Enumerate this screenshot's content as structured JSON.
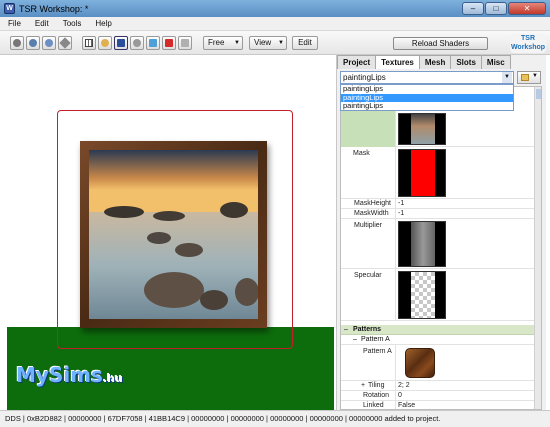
{
  "window": {
    "title": "TSR Workshop: *",
    "minimize": "–",
    "maximize": "□",
    "close": "✕",
    "app_icon": "W"
  },
  "menu": [
    "File",
    "Edit",
    "Tools",
    "Help"
  ],
  "toolbar": {
    "view_mode_dropdown": "Free",
    "view_dropdown": "View",
    "edit_button": "Edit",
    "reload_button": "Reload Shaders",
    "logo_text": "TSR Workshop"
  },
  "viewport": {
    "watermark": "MySims",
    "watermark_suffix": ".hu"
  },
  "panel": {
    "tabs": [
      "Project",
      "Textures",
      "Mesh",
      "Slots",
      "Misc"
    ],
    "active_tab": "Textures",
    "combo": {
      "selected": "paintingLips",
      "options": [
        "paintingLips",
        "paintingLips",
        "paintingLips"
      ],
      "highlighted_index": 1
    },
    "props": [
      {
        "name": "Mask",
        "kind": "texture"
      },
      {
        "name": "MaskHeight",
        "value": "-1"
      },
      {
        "name": "MaskWidth",
        "value": "-1"
      },
      {
        "name": "Multiplier",
        "kind": "texture"
      },
      {
        "name": "Specular",
        "kind": "texture"
      }
    ],
    "patterns": {
      "section_label": "Patterns",
      "section_toggle": "–",
      "sub_label": "Pattern A",
      "sub_toggle": "–",
      "item_label": "Pattern A",
      "tiling_toggle": "+",
      "tiling_label": "Tiling",
      "tiling_value": "2; 2",
      "rotation_label": "Rotation",
      "rotation_value": "0",
      "linked_label": "Linked",
      "linked_value": "False"
    }
  },
  "status": "DDS | 0xB2D882 | 00000000 | 67DF7058 | 41BB14C9 | 00000000 | 00000000 | 00000000 | 00000000 | 00000000 added to project."
}
